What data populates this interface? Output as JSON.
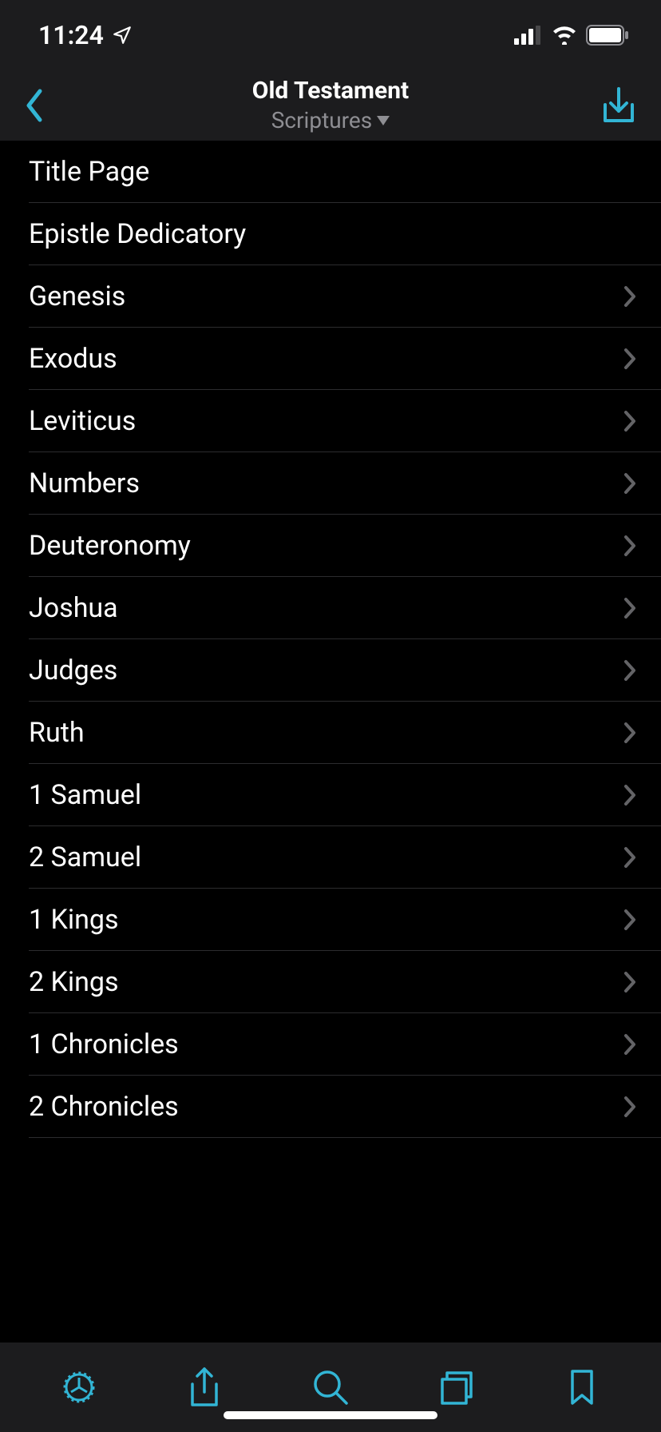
{
  "status": {
    "time": "11:24"
  },
  "nav": {
    "title": "Old Testament",
    "subtitle": "Scriptures"
  },
  "books": [
    {
      "label": "Title Page",
      "chevron": false
    },
    {
      "label": "Epistle Dedicatory",
      "chevron": false
    },
    {
      "label": "Genesis",
      "chevron": true
    },
    {
      "label": "Exodus",
      "chevron": true
    },
    {
      "label": "Leviticus",
      "chevron": true
    },
    {
      "label": "Numbers",
      "chevron": true
    },
    {
      "label": "Deuteronomy",
      "chevron": true
    },
    {
      "label": "Joshua",
      "chevron": true
    },
    {
      "label": "Judges",
      "chevron": true
    },
    {
      "label": "Ruth",
      "chevron": true
    },
    {
      "label": "1 Samuel",
      "chevron": true
    },
    {
      "label": "2 Samuel",
      "chevron": true
    },
    {
      "label": "1 Kings",
      "chevron": true
    },
    {
      "label": "2 Kings",
      "chevron": true
    },
    {
      "label": "1 Chronicles",
      "chevron": true
    },
    {
      "label": "2 Chronicles",
      "chevron": true
    }
  ],
  "colors": {
    "accent": "#32b5d5",
    "background": "#000000",
    "barBackground": "#1c1c1e",
    "divider": "#2c2c2e",
    "secondaryText": "#8e8e93",
    "chevron": "#636366"
  }
}
